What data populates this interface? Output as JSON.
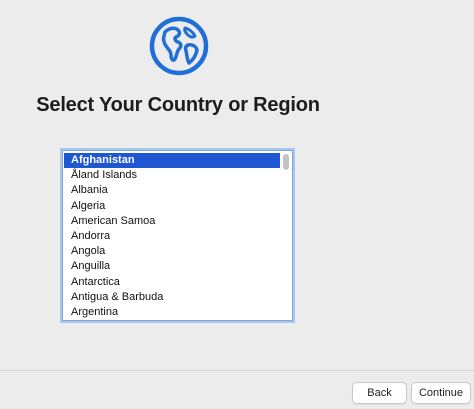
{
  "header": {
    "icon": "globe-icon",
    "title": "Select Your Country or Region",
    "accent_color": "#1f6fd6"
  },
  "country_list": {
    "selected_index": 0,
    "selection_color": "#1f56d2",
    "items": [
      "Afghanistan",
      "Åland Islands",
      "Albania",
      "Algeria",
      "American Samoa",
      "Andorra",
      "Angola",
      "Anguilla",
      "Antarctica",
      "Antigua & Barbuda",
      "Argentina"
    ]
  },
  "footer": {
    "back_label": "Back",
    "continue_label": "Continue"
  }
}
